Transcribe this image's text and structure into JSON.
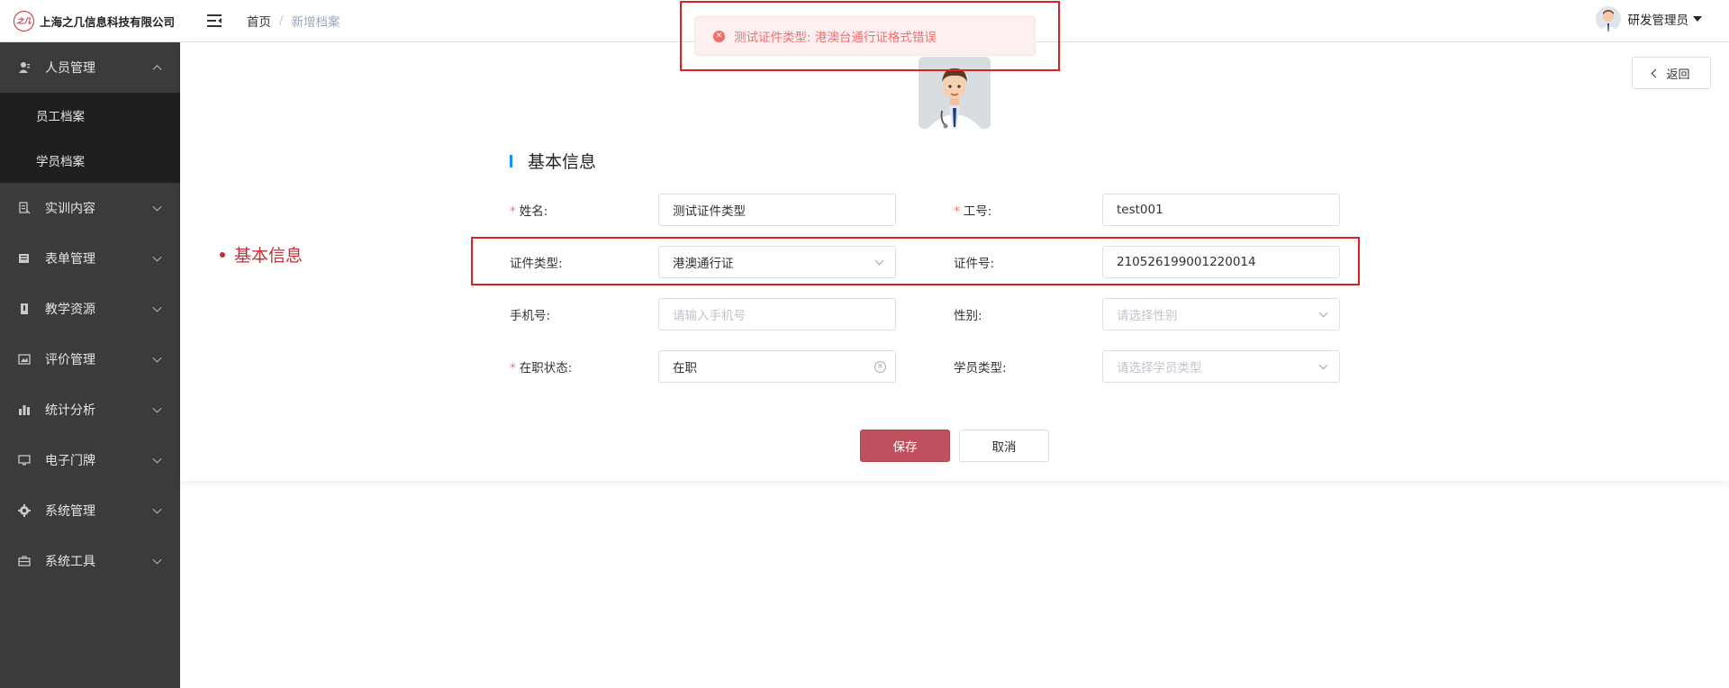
{
  "header": {
    "company_name": "上海之几信息科技有限公司",
    "logo_mark": "之几",
    "breadcrumb": {
      "home": "首页",
      "separator": "/",
      "current": "新增档案"
    },
    "user_name": "研发管理员"
  },
  "sidebar": {
    "items": [
      {
        "label": "人员管理",
        "icon": "user-icon",
        "expanded": true,
        "children": [
          {
            "label": "员工档案"
          },
          {
            "label": "学员档案"
          }
        ]
      },
      {
        "label": "实训内容",
        "icon": "document-icon"
      },
      {
        "label": "表单管理",
        "icon": "form-icon"
      },
      {
        "label": "教学资源",
        "icon": "book-icon"
      },
      {
        "label": "评价管理",
        "icon": "image-icon"
      },
      {
        "label": "统计分析",
        "icon": "bar-chart-icon"
      },
      {
        "label": "电子门牌",
        "icon": "monitor-icon"
      },
      {
        "label": "系统管理",
        "icon": "gear-icon"
      },
      {
        "label": "系统工具",
        "icon": "toolbox-icon"
      }
    ]
  },
  "toast": {
    "message": "测试证件类型: 港澳台通行证格式错误",
    "type": "error"
  },
  "content": {
    "back_label": "返回",
    "side_anchor": "基本信息",
    "section_title": "基本信息",
    "form": {
      "name": {
        "label": "姓名:",
        "required": true,
        "value": "测试证件类型"
      },
      "employee_no": {
        "label": "工号:",
        "required": true,
        "value": "test001"
      },
      "id_type": {
        "label": "证件类型:",
        "required": false,
        "value": "港澳通行证"
      },
      "id_number": {
        "label": "证件号:",
        "required": false,
        "value": "210526199001220014"
      },
      "phone": {
        "label": "手机号:",
        "required": false,
        "placeholder": "请输入手机号"
      },
      "gender": {
        "label": "性别:",
        "required": false,
        "placeholder": "请选择性别"
      },
      "job_status": {
        "label": "在职状态:",
        "required": true,
        "value": "在职"
      },
      "student_type": {
        "label": "学员类型:",
        "required": false,
        "placeholder": "请选择学员类型"
      }
    },
    "save_label": "保存",
    "cancel_label": "取消"
  },
  "colors": {
    "sidebar_bg": "#3b3b3b",
    "submenu_bg": "#1f1f1f",
    "brand_red": "#c0303b",
    "save_button": "#c0505e",
    "error_text": "#f56c6c",
    "section_bar": "#1890ff",
    "annotation_box": "#e02020"
  }
}
